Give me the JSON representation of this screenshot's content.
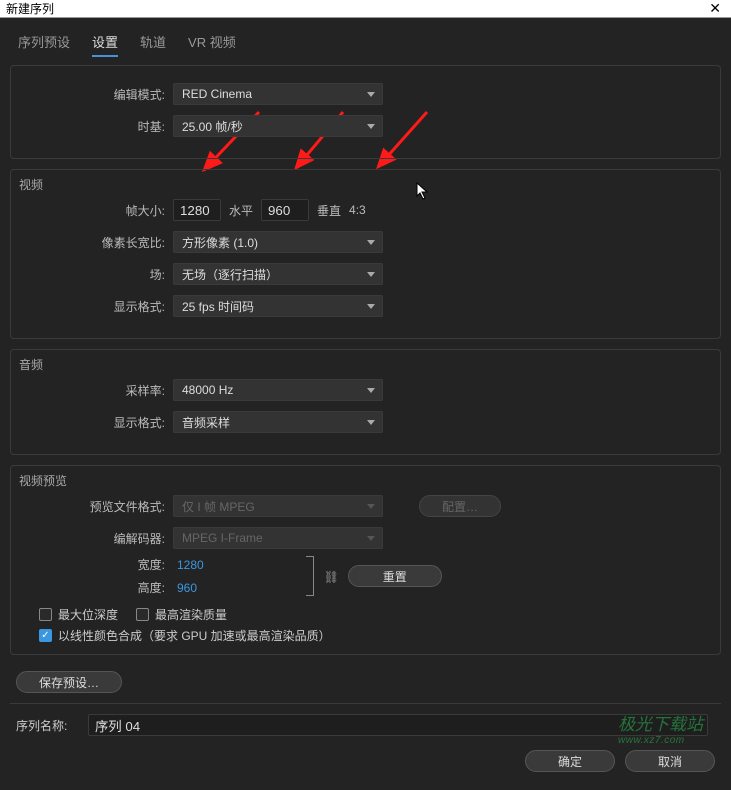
{
  "window": {
    "title": "新建序列"
  },
  "tabs": {
    "preset": "序列预设",
    "settings": "设置",
    "tracks": "轨道",
    "vr": "VR 视频"
  },
  "top": {
    "edit_mode_label": "编辑模式:",
    "edit_mode_value": "RED Cinema",
    "timebase_label": "时基:",
    "timebase_value": "25.00 帧/秒"
  },
  "video": {
    "section": "视频",
    "frame_size_label": "帧大小:",
    "width": "1280",
    "h_label": "水平",
    "height": "960",
    "v_label": "垂直",
    "aspect": "4:3",
    "par_label": "像素长宽比:",
    "par_value": "方形像素 (1.0)",
    "fields_label": "场:",
    "fields_value": "无场（逐行扫描）",
    "display_fmt_label": "显示格式:",
    "display_fmt_value": "25 fps 时间码"
  },
  "audio": {
    "section": "音频",
    "sample_rate_label": "采样率:",
    "sample_rate_value": "48000 Hz",
    "display_fmt_label": "显示格式:",
    "display_fmt_value": "音频采样"
  },
  "preview": {
    "section": "视频预览",
    "file_fmt_label": "预览文件格式:",
    "file_fmt_value": "仅 I 帧 MPEG",
    "config_btn": "配置…",
    "codec_label": "编解码器:",
    "codec_value": "MPEG I-Frame",
    "width_label": "宽度:",
    "width_value": "1280",
    "height_label": "高度:",
    "height_value": "960",
    "reset_btn": "重置"
  },
  "checks": {
    "max_bit": "最大位深度",
    "max_quality": "最高渲染质量",
    "linear": "以线性颜色合成（要求 GPU 加速或最高渲染品质）"
  },
  "buttons": {
    "save_preset": "保存预设…",
    "ok": "确定",
    "cancel": "取消"
  },
  "sequence_name": {
    "label": "序列名称:",
    "value": "序列 04"
  },
  "watermark": {
    "line1": "极光下载站",
    "line2": "www.xz7.com"
  }
}
